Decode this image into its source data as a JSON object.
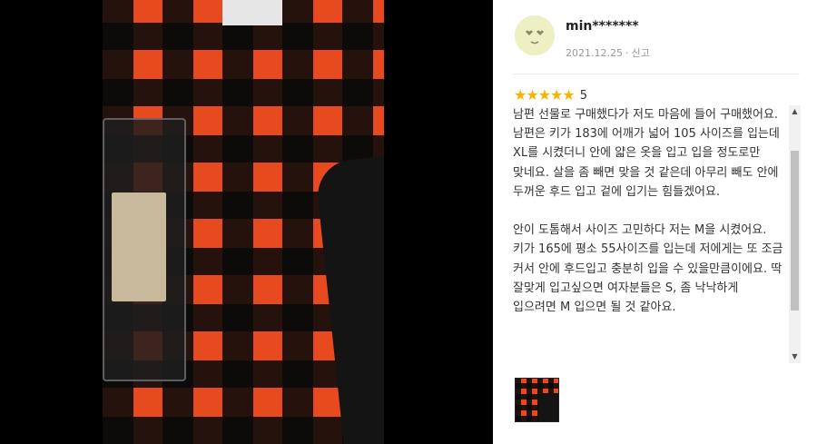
{
  "review": {
    "username": "min*******",
    "date": "2021.12.25",
    "separator": "·",
    "report_label": "신고",
    "rating": 5,
    "rating_label": "5",
    "star_char": "★",
    "body": "남편 선물로 구매했다가 저도 마음에 들어 구매했어요.\n남편은 키가 183에 어깨가 넓어 105 사이즈를 입는데 XL를 시켰더니 안에 얇은 옷을 입고 입을 정도로만 맞네요. 살을 좀 빼면 맞을 것 같은데 아무리 빼도 안에 두꺼운 후드 입고 겉에 입기는 힘들겠어요.\n\n안이 도톰해서 사이즈 고민하다 저는 M을 시켰어요.\n키가 165에 평소 55사이즈를 입는데 저에게는 또 조금 커서 안에 후드입고 충분히 입을 수 있을만큼이에요. 딱 잘맞게 입고싶으면 여자분들은 S, 좀 낙낙하게 입으려면 M 입으면 될 것 같아요."
  },
  "scrollbar": {
    "up_arrow": "▲",
    "down_arrow": "▼"
  },
  "icons": {
    "avatar": "smiley-heart-eyes-avatar-icon",
    "star": "star-icon",
    "scroll_up": "triangle-up-icon",
    "scroll_down": "triangle-down-icon"
  },
  "colors": {
    "star": "#f5b400",
    "plaid_red": "#e84a1f",
    "plaid_black": "#0a0a0a",
    "avatar_bg": "#eef0c4",
    "meta_text": "#999999"
  }
}
